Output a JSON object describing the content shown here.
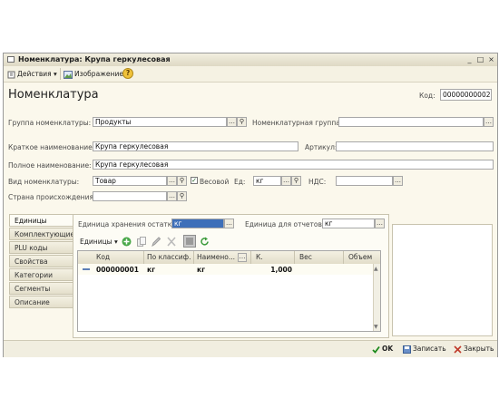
{
  "window": {
    "title": "Номенклатура: Крупа геркулесовая",
    "controls": [
      "_",
      "□",
      "×"
    ]
  },
  "toolbar": {
    "actions_label": "Действия",
    "image_label": "Изображение",
    "help_label": "?"
  },
  "form": {
    "heading": "Номенклатура",
    "code_label": "Код:",
    "code_value": "00000000002",
    "group_label": "Группа номенклатуры:",
    "group_value": "Продукты",
    "nom_group_label": "Номенклатурная группа:",
    "nom_group_value": "",
    "short_name_label": "Краткое наименование:",
    "short_name_value": "Крупа геркулесовая",
    "article_label": "Артикул:",
    "article_value": "",
    "full_name_label": "Полное наименование:",
    "full_name_value": "Крупа геркулесовая",
    "kind_label": "Вид номенклатуры:",
    "kind_value": "Товар",
    "weight_label": "Весовой",
    "weight_checked": true,
    "unit_label": "Ед:",
    "unit_value": "кг",
    "vat_label": "НДС:",
    "vat_value": "",
    "country_label": "Страна происхождения:",
    "country_value": ""
  },
  "tabs": [
    {
      "label": "Единицы",
      "active": true
    },
    {
      "label": "Комплектующие",
      "active": false
    },
    {
      "label": "PLU коды",
      "active": false
    },
    {
      "label": "Свойства",
      "active": false
    },
    {
      "label": "Категории",
      "active": false
    },
    {
      "label": "Сегменты",
      "active": false
    },
    {
      "label": "Описание",
      "active": false
    }
  ],
  "units_tab": {
    "storage_unit_label": "Единица хранения остатков:",
    "storage_unit_value": "кг",
    "report_unit_label": "Единица для отчетов:",
    "report_unit_value": "кг",
    "grid_menu_label": "Единицы",
    "columns": [
      "Код",
      "По классиф.",
      "Наимено...",
      "К.",
      "Вес",
      "Объем"
    ],
    "rows": [
      {
        "code": "000000001",
        "classifier": "кг",
        "name": "кг",
        "coef": "1,000",
        "weight": "",
        "volume": ""
      }
    ]
  },
  "footer": {
    "ok_label": "OK",
    "save_label": "Записать",
    "close_label": "Закрыть"
  },
  "colors": {
    "window_bg": "#fbf8ec",
    "selection": "#3d6fb9",
    "ok_green": "#1c8a1c"
  }
}
